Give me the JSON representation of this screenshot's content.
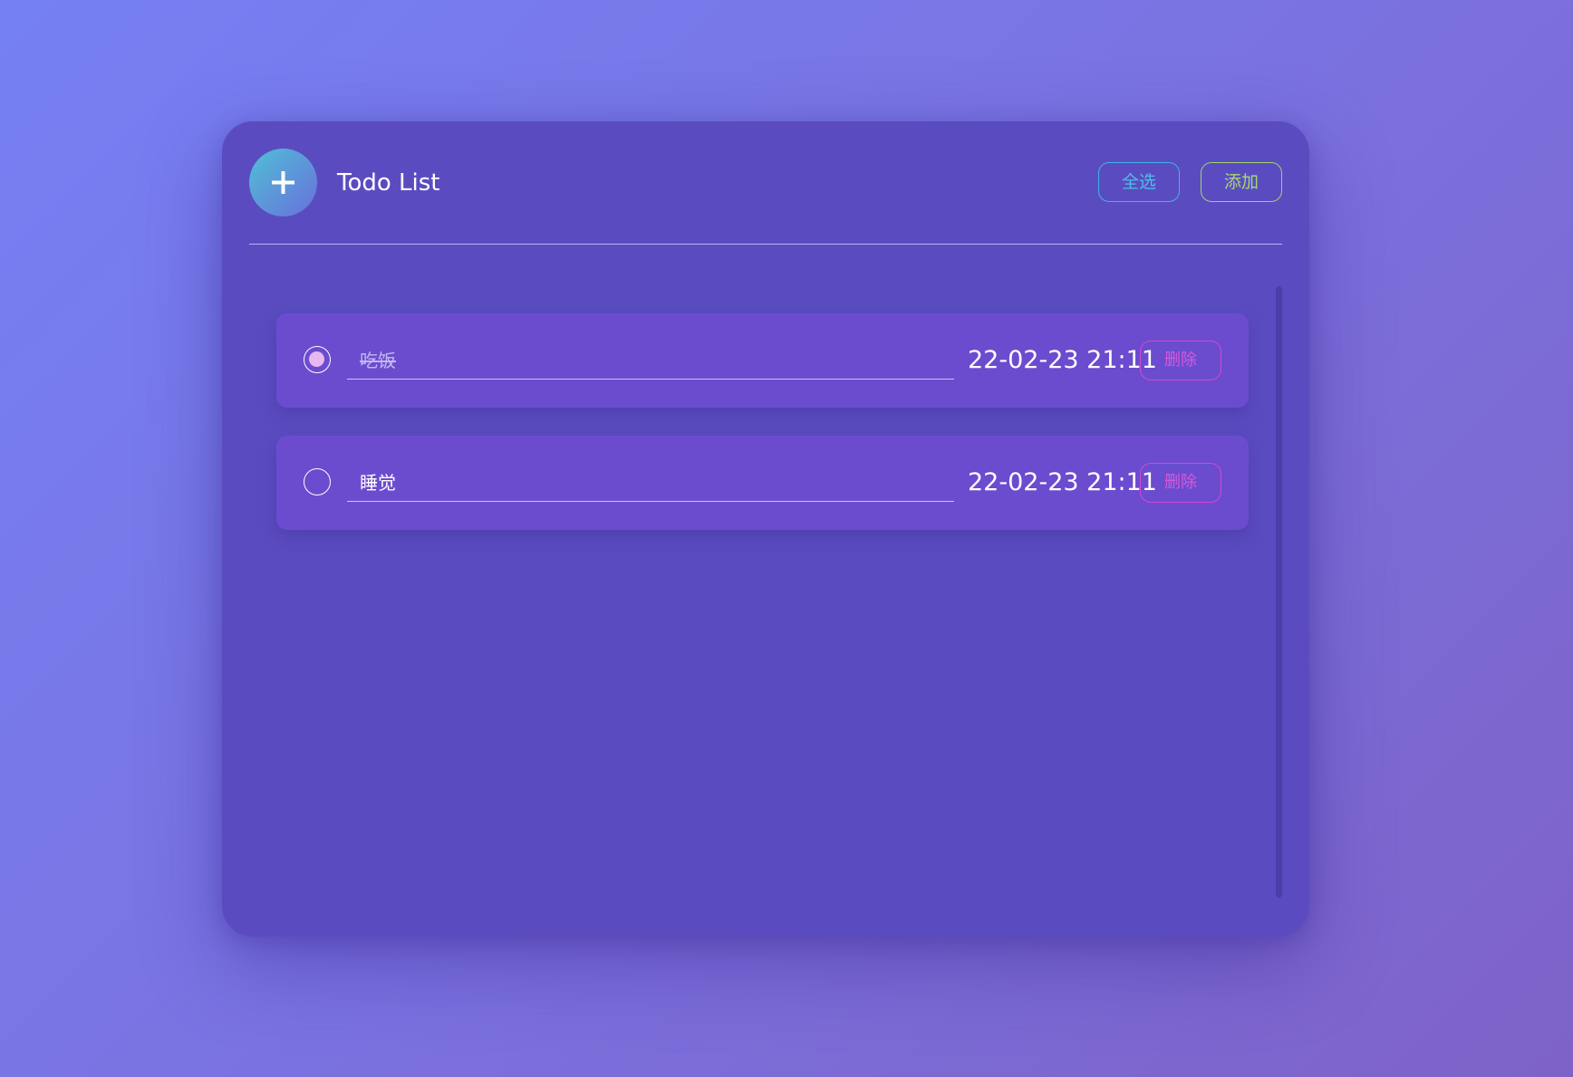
{
  "app": {
    "title": "Todo List",
    "add_icon": "plus-icon"
  },
  "toolbar": {
    "select_all_label": "全选",
    "add_label": "添加"
  },
  "todos": [
    {
      "text": "吃饭",
      "done": true,
      "time": "22-02-23 21:11",
      "delete_label": "删除"
    },
    {
      "text": "睡觉",
      "done": false,
      "time": "22-02-23 21:11",
      "delete_label": "删除"
    }
  ],
  "colors": {
    "background_start": "#7580f3",
    "background_end": "#7e62c7",
    "card": "#5a4cc0",
    "item": "#6b4ccf",
    "select_all_accent": "#4cc0ea",
    "add_accent": "#a6d872",
    "delete_accent": "#d45ad8",
    "checked_dot": "#e8b7ee"
  }
}
